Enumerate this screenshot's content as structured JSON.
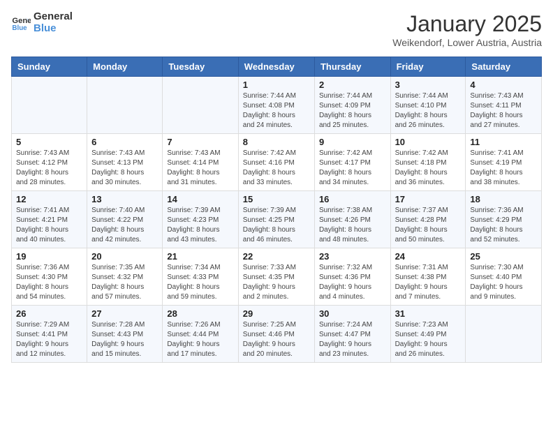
{
  "logo": {
    "line1": "General",
    "line2": "Blue"
  },
  "title": "January 2025",
  "location": "Weikendorf, Lower Austria, Austria",
  "weekdays": [
    "Sunday",
    "Monday",
    "Tuesday",
    "Wednesday",
    "Thursday",
    "Friday",
    "Saturday"
  ],
  "weeks": [
    [
      {
        "day": "",
        "info": ""
      },
      {
        "day": "",
        "info": ""
      },
      {
        "day": "",
        "info": ""
      },
      {
        "day": "1",
        "info": "Sunrise: 7:44 AM\nSunset: 4:08 PM\nDaylight: 8 hours\nand 24 minutes."
      },
      {
        "day": "2",
        "info": "Sunrise: 7:44 AM\nSunset: 4:09 PM\nDaylight: 8 hours\nand 25 minutes."
      },
      {
        "day": "3",
        "info": "Sunrise: 7:44 AM\nSunset: 4:10 PM\nDaylight: 8 hours\nand 26 minutes."
      },
      {
        "day": "4",
        "info": "Sunrise: 7:43 AM\nSunset: 4:11 PM\nDaylight: 8 hours\nand 27 minutes."
      }
    ],
    [
      {
        "day": "5",
        "info": "Sunrise: 7:43 AM\nSunset: 4:12 PM\nDaylight: 8 hours\nand 28 minutes."
      },
      {
        "day": "6",
        "info": "Sunrise: 7:43 AM\nSunset: 4:13 PM\nDaylight: 8 hours\nand 30 minutes."
      },
      {
        "day": "7",
        "info": "Sunrise: 7:43 AM\nSunset: 4:14 PM\nDaylight: 8 hours\nand 31 minutes."
      },
      {
        "day": "8",
        "info": "Sunrise: 7:42 AM\nSunset: 4:16 PM\nDaylight: 8 hours\nand 33 minutes."
      },
      {
        "day": "9",
        "info": "Sunrise: 7:42 AM\nSunset: 4:17 PM\nDaylight: 8 hours\nand 34 minutes."
      },
      {
        "day": "10",
        "info": "Sunrise: 7:42 AM\nSunset: 4:18 PM\nDaylight: 8 hours\nand 36 minutes."
      },
      {
        "day": "11",
        "info": "Sunrise: 7:41 AM\nSunset: 4:19 PM\nDaylight: 8 hours\nand 38 minutes."
      }
    ],
    [
      {
        "day": "12",
        "info": "Sunrise: 7:41 AM\nSunset: 4:21 PM\nDaylight: 8 hours\nand 40 minutes."
      },
      {
        "day": "13",
        "info": "Sunrise: 7:40 AM\nSunset: 4:22 PM\nDaylight: 8 hours\nand 42 minutes."
      },
      {
        "day": "14",
        "info": "Sunrise: 7:39 AM\nSunset: 4:23 PM\nDaylight: 8 hours\nand 43 minutes."
      },
      {
        "day": "15",
        "info": "Sunrise: 7:39 AM\nSunset: 4:25 PM\nDaylight: 8 hours\nand 46 minutes."
      },
      {
        "day": "16",
        "info": "Sunrise: 7:38 AM\nSunset: 4:26 PM\nDaylight: 8 hours\nand 48 minutes."
      },
      {
        "day": "17",
        "info": "Sunrise: 7:37 AM\nSunset: 4:28 PM\nDaylight: 8 hours\nand 50 minutes."
      },
      {
        "day": "18",
        "info": "Sunrise: 7:36 AM\nSunset: 4:29 PM\nDaylight: 8 hours\nand 52 minutes."
      }
    ],
    [
      {
        "day": "19",
        "info": "Sunrise: 7:36 AM\nSunset: 4:30 PM\nDaylight: 8 hours\nand 54 minutes."
      },
      {
        "day": "20",
        "info": "Sunrise: 7:35 AM\nSunset: 4:32 PM\nDaylight: 8 hours\nand 57 minutes."
      },
      {
        "day": "21",
        "info": "Sunrise: 7:34 AM\nSunset: 4:33 PM\nDaylight: 8 hours\nand 59 minutes."
      },
      {
        "day": "22",
        "info": "Sunrise: 7:33 AM\nSunset: 4:35 PM\nDaylight: 9 hours\nand 2 minutes."
      },
      {
        "day": "23",
        "info": "Sunrise: 7:32 AM\nSunset: 4:36 PM\nDaylight: 9 hours\nand 4 minutes."
      },
      {
        "day": "24",
        "info": "Sunrise: 7:31 AM\nSunset: 4:38 PM\nDaylight: 9 hours\nand 7 minutes."
      },
      {
        "day": "25",
        "info": "Sunrise: 7:30 AM\nSunset: 4:40 PM\nDaylight: 9 hours\nand 9 minutes."
      }
    ],
    [
      {
        "day": "26",
        "info": "Sunrise: 7:29 AM\nSunset: 4:41 PM\nDaylight: 9 hours\nand 12 minutes."
      },
      {
        "day": "27",
        "info": "Sunrise: 7:28 AM\nSunset: 4:43 PM\nDaylight: 9 hours\nand 15 minutes."
      },
      {
        "day": "28",
        "info": "Sunrise: 7:26 AM\nSunset: 4:44 PM\nDaylight: 9 hours\nand 17 minutes."
      },
      {
        "day": "29",
        "info": "Sunrise: 7:25 AM\nSunset: 4:46 PM\nDaylight: 9 hours\nand 20 minutes."
      },
      {
        "day": "30",
        "info": "Sunrise: 7:24 AM\nSunset: 4:47 PM\nDaylight: 9 hours\nand 23 minutes."
      },
      {
        "day": "31",
        "info": "Sunrise: 7:23 AM\nSunset: 4:49 PM\nDaylight: 9 hours\nand 26 minutes."
      },
      {
        "day": "",
        "info": ""
      }
    ]
  ]
}
